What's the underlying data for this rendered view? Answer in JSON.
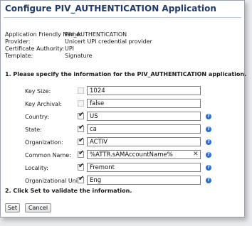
{
  "title": "Configure PIV_AUTHENTICATION Application",
  "info": [
    {
      "label": "Application Friendly Name:",
      "value": "PIV_AUTHENTICATION"
    },
    {
      "label": "Provider:",
      "value": "Unicert UPI credential provider"
    },
    {
      "label": "Certificate Authority:",
      "value": "UPI"
    },
    {
      "label": "Template:",
      "value": "Signature"
    }
  ],
  "section1": "1. Please specify the information for the PIV_AUTHENTICATION application.",
  "section2": "2. Click Set to validate the information.",
  "fields": [
    {
      "label": "Key Size:",
      "value": "1024",
      "checked": false,
      "help": false,
      "clear": false
    },
    {
      "label": "Key Archival:",
      "value": "false",
      "checked": false,
      "help": false,
      "clear": false
    },
    {
      "label": "Country:",
      "value": "US",
      "checked": true,
      "help": true,
      "clear": false
    },
    {
      "label": "State:",
      "value": "ca",
      "checked": true,
      "help": true,
      "clear": false
    },
    {
      "label": "Organization:",
      "value": "ACTIV",
      "checked": true,
      "help": true,
      "clear": false
    },
    {
      "label": "Common Name:",
      "value": "%ATTR.sAMAccountName%",
      "checked": true,
      "help": true,
      "clear": true
    },
    {
      "label": "Locality:",
      "value": "Fremont",
      "checked": true,
      "help": true,
      "clear": false
    },
    {
      "label": "Organizational Unit:",
      "value": "Eng",
      "checked": true,
      "help": true,
      "clear": false
    }
  ],
  "icons": {
    "checkmark": "✔",
    "clear": "✕",
    "help": "?"
  },
  "buttons": {
    "set": "Set",
    "cancel": "Cancel"
  },
  "colors": {
    "title": "#1f3b6b",
    "help_icon": "#2a6fd6"
  }
}
